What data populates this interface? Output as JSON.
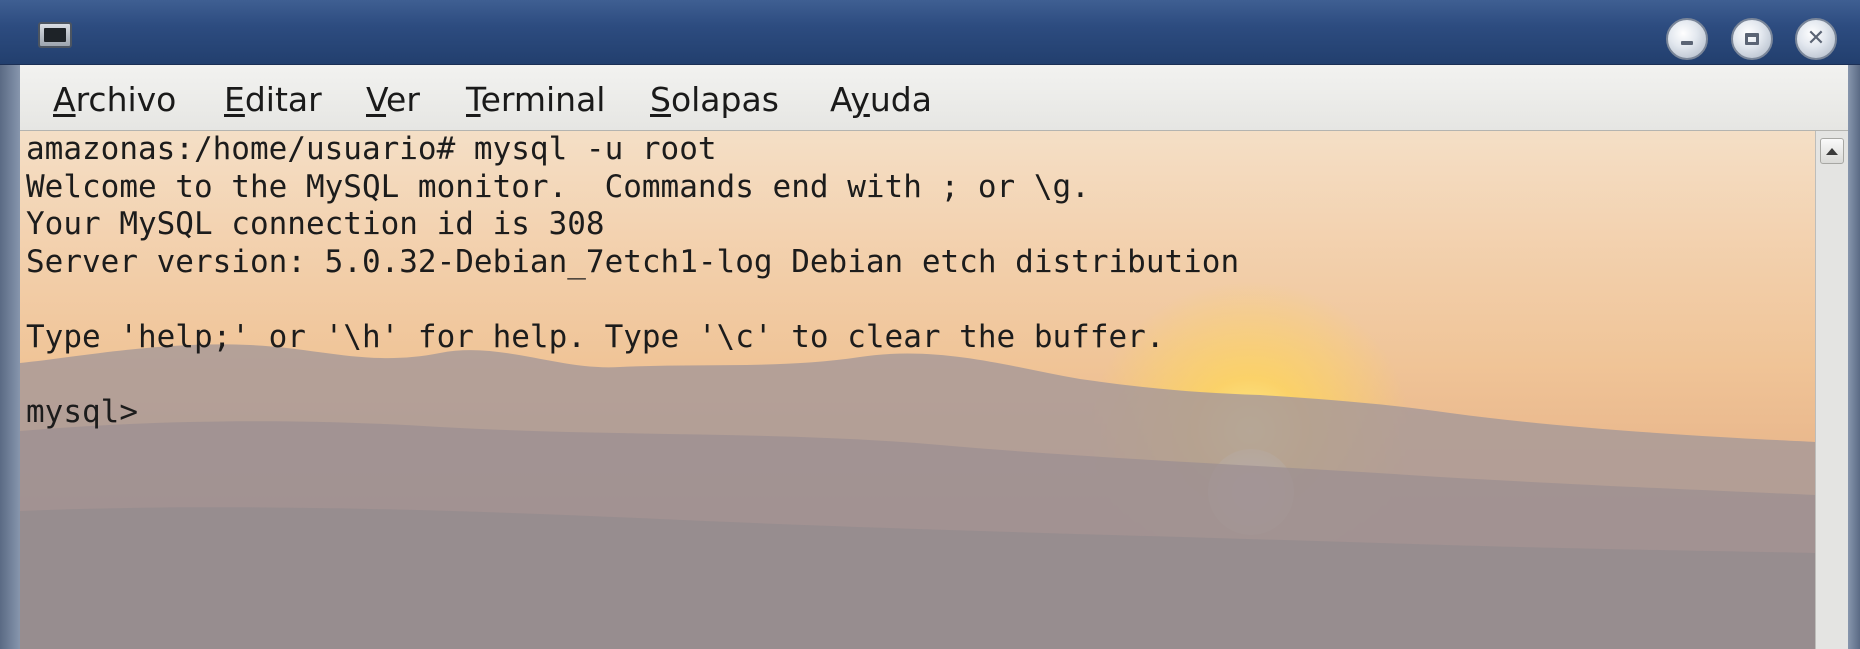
{
  "window": {
    "icon": "terminal-icon",
    "controls": {
      "minimize_icon": "minimize-icon",
      "maximize_icon": "maximize-icon",
      "close_glyph": "✕"
    }
  },
  "menu": {
    "items": [
      {
        "mnemonic": "A",
        "rest": "rchivo"
      },
      {
        "mnemonic": "E",
        "rest": "ditar"
      },
      {
        "mnemonic": "V",
        "rest": "er"
      },
      {
        "mnemonic": "T",
        "rest": "erminal"
      },
      {
        "mnemonic": "S",
        "rest": "olapas"
      },
      {
        "prefix": "A",
        "mnemonic": "y",
        "rest": "uda"
      }
    ]
  },
  "terminal": {
    "lines": [
      "amazonas:/home/usuario# mysql -u root",
      "Welcome to the MySQL monitor.  Commands end with ; or \\g.",
      "Your MySQL connection id is 308",
      "Server version: 5.0.32-Debian_7etch1-log Debian etch distribution",
      "",
      "Type 'help;' or '\\h' for help. Type '\\c' to clear the buffer.",
      "",
      "mysql> "
    ]
  },
  "scrollbar": {
    "up_icon": "scroll-up-arrow-icon"
  }
}
